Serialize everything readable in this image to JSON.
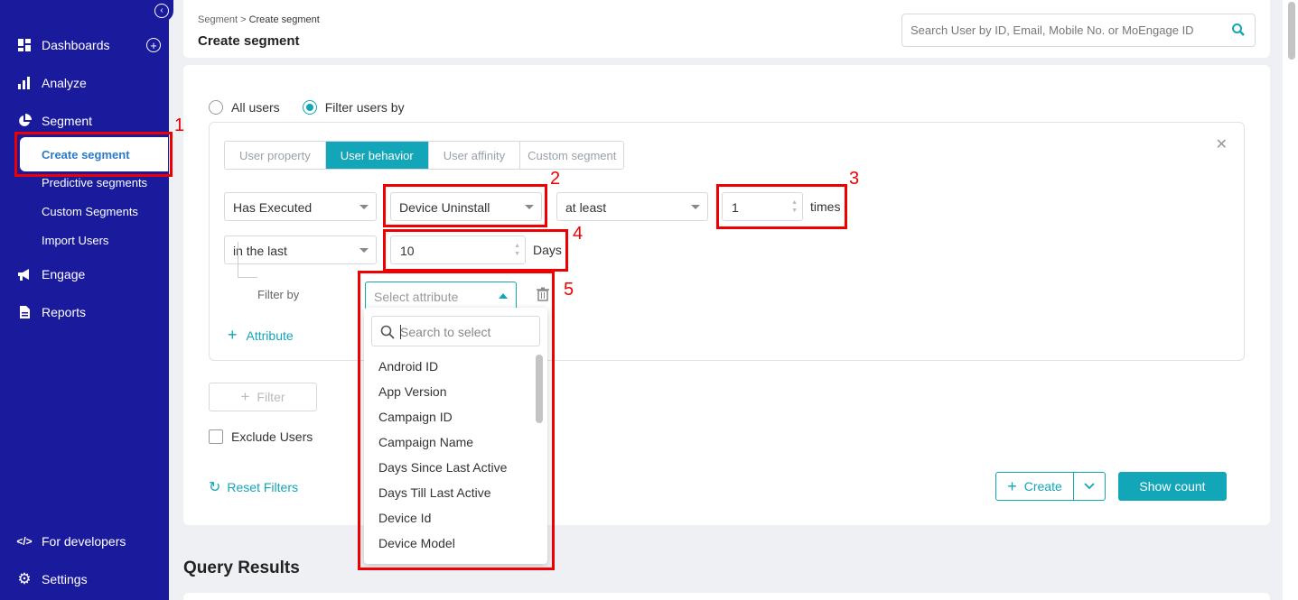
{
  "sidebar": {
    "items": [
      {
        "label": "Dashboards",
        "icon": "dashboard-icon"
      },
      {
        "label": "Analyze",
        "icon": "bar-chart-icon"
      },
      {
        "label": "Segment",
        "icon": "pie-chart-icon"
      },
      {
        "label": "Engage",
        "icon": "megaphone-icon"
      },
      {
        "label": "Reports",
        "icon": "document-icon"
      }
    ],
    "segment_sub": [
      "Create segment",
      "Predictive segments",
      "Custom Segments",
      "Import Users"
    ],
    "bottom": [
      {
        "label": "For developers",
        "icon": "code-icon"
      },
      {
        "label": "Settings",
        "icon": "gear-icon"
      }
    ]
  },
  "header": {
    "breadcrumb_parent": "Segment",
    "breadcrumb_sep": " > ",
    "breadcrumb_current": "Create segment",
    "title": "Create segment",
    "search_placeholder": "Search User by ID, Email, Mobile No. or MoEngage ID"
  },
  "segment": {
    "radio_all": "All users",
    "radio_filter": "Filter users by",
    "tabs": [
      "User property",
      "User behavior",
      "User affinity",
      "Custom segment"
    ],
    "active_tab": "User behavior",
    "row1": {
      "condition": "Has Executed",
      "event": "Device Uninstall",
      "qualifier": "at least",
      "count": "1",
      "unit": "times"
    },
    "row2": {
      "period": "in the last",
      "value": "10",
      "unit": "Days"
    },
    "filter_by_label": "Filter by",
    "attribute_placeholder": "Select attribute",
    "add_attribute": "Attribute",
    "filter_button": "Filter",
    "exclude_users": "Exclude Users",
    "reset_filters": "Reset Filters",
    "create": "Create",
    "show_count": "Show count"
  },
  "dropdown": {
    "search_placeholder": "Search to select",
    "options": [
      "Android ID",
      "App Version",
      "Campaign ID",
      "Campaign Name",
      "Days Since Last Active",
      "Days Till Last Active",
      "Device Id",
      "Device Model"
    ]
  },
  "annotations": [
    "1",
    "2",
    "3",
    "4",
    "5"
  ],
  "query_results_title": "Query Results",
  "colors": {
    "sidebar": "#1a1a9c",
    "accent": "#13a5b8",
    "annotation": "#e00000"
  }
}
